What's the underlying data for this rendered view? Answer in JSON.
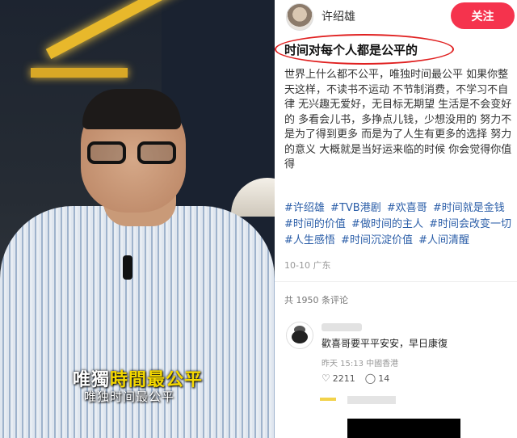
{
  "video": {
    "subtitle_main_prefix": "唯獨",
    "subtitle_main_highlight": "時間最公平",
    "subtitle_secondary": "唯独时间最公平"
  },
  "author": {
    "name": "许绍雄",
    "follow_label": "关注"
  },
  "post": {
    "title": "时间对每个人都是公平的",
    "body": "世界上什么都不公平，唯独时间最公平 如果你整天这样，不读书不运动 不节制消费，不学习不自律 无兴趣无爱好，无目标无期望 生活是不会变好的 多看会儿书，多挣点儿钱，少想没用的 努力不是为了得到更多 而是为了人生有更多的选择 努力的意义 大概就是当好运来临的时候 你会觉得你值得",
    "tags": [
      "#许绍雄",
      "#TVB港剧",
      "#欢喜哥",
      "#时间就是金钱",
      "#时间的价值",
      "#做时间的主人",
      "#时间会改变一切",
      "#人生感悟",
      "#时间沉淀价值",
      "#人间清醒"
    ],
    "meta": "10-10 广东"
  },
  "comments": {
    "count_label": "共 1950 条评论",
    "items": [
      {
        "text": "歡喜哥要平平安安，早日康復",
        "meta": "昨天 15:13 中國香港",
        "likes": "2211",
        "replies": "14"
      }
    ]
  },
  "colors": {
    "accent": "#f5334d",
    "tag": "#2b5ea8",
    "highlight": "#f5d800"
  }
}
